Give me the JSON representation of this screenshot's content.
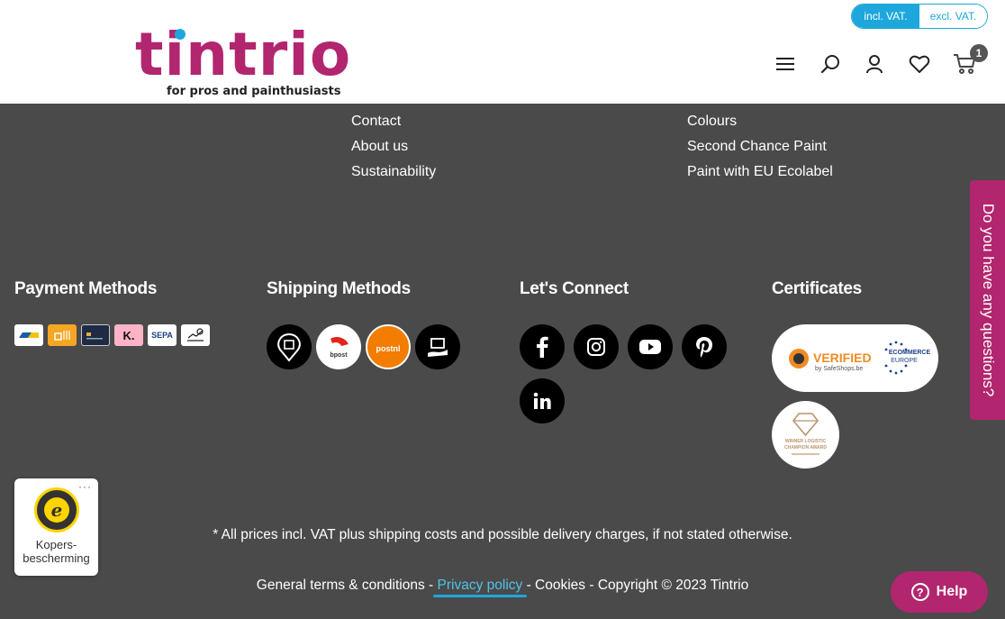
{
  "header": {
    "logo_text": "tintrio",
    "logo_tagline": "for pros and painthusiasts",
    "vat_incl": "incl. VAT.",
    "vat_excl": "excl. VAT.",
    "cart_count": "1",
    "icons": [
      "menu-icon",
      "search-icon",
      "user-icon",
      "heart-icon",
      "cart-icon"
    ]
  },
  "footer": {
    "links_left": [
      "Contact",
      "About us",
      "Sustainability"
    ],
    "links_right": [
      "Colours",
      "Second Chance Paint",
      "Paint with EU Ecolabel"
    ],
    "columns": {
      "payment": "Payment Methods",
      "shipping": "Shipping Methods",
      "connect": "Let's Connect",
      "certificates": "Certificates"
    },
    "payment_badges": [
      "bancontact",
      "payconiq",
      "card",
      "K.",
      "SEPA",
      "transfer"
    ],
    "shipping_logos": [
      "pickup",
      "bpost",
      "postnl",
      "delivery"
    ],
    "social": [
      "facebook",
      "instagram",
      "youtube",
      "pinterest",
      "linkedin"
    ],
    "cert_verified": "VERIFIED",
    "cert_verified_sub": "by SafeShops.be",
    "cert_ecommerce": "ECOMMERCE",
    "cert_europe": "EUROPE",
    "cert_award_1": "WINNER LOGISTIC",
    "cert_award_2": "CHAMPION AWARD",
    "prices_note": "* All prices incl. VAT plus shipping costs and possible delivery charges, if not stated otherwise.",
    "legal": {
      "terms": "General terms & conditions",
      "sep": " - ",
      "privacy": "Privacy policy",
      "cookies": "Cookies",
      "copyright": "Copyright © 2023 Tintrio"
    }
  },
  "widgets": {
    "questions_tab": "Do you have any questions?",
    "trust_label_1": "Kopers-",
    "trust_label_2": "bescherming",
    "help": "Help"
  },
  "colors": {
    "brand": "#b1266e",
    "accent": "#1ea7dc",
    "footer_bg": "#4a4a4a"
  }
}
